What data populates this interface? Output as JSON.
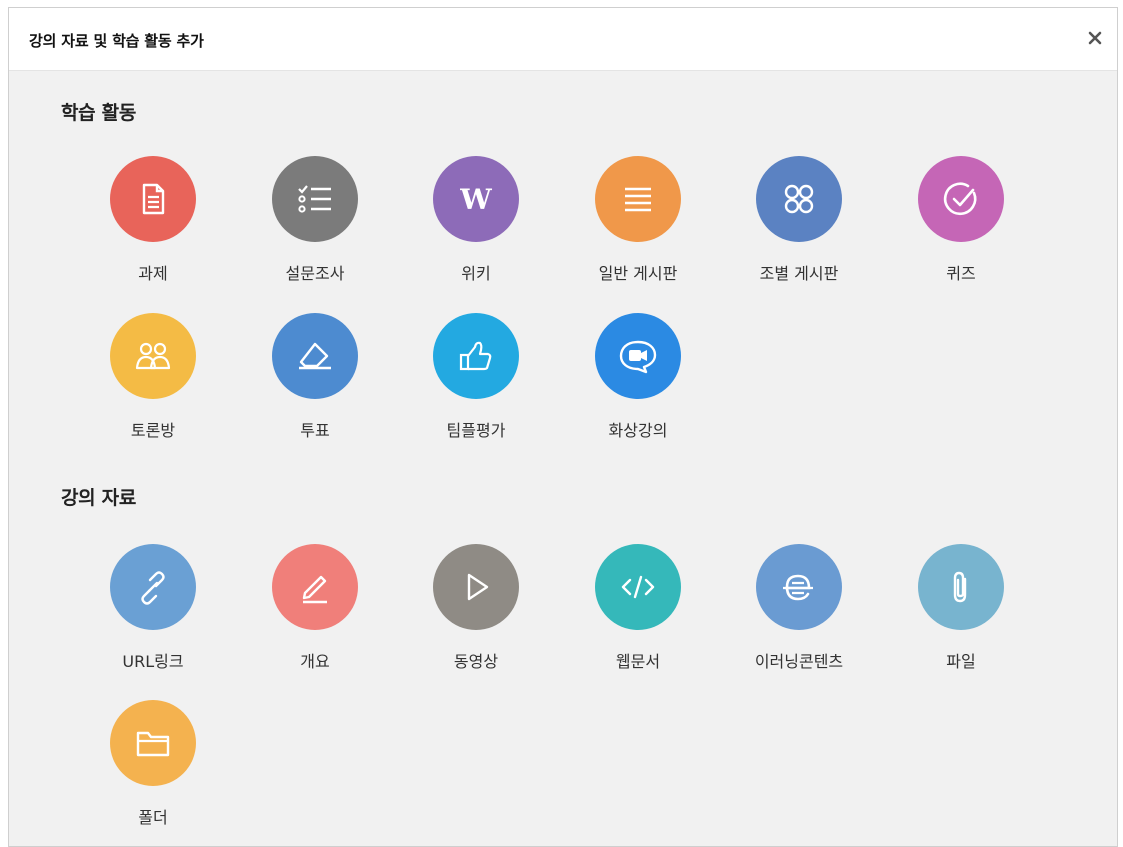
{
  "modal": {
    "title": "강의 자료 및 학습 활동 추가"
  },
  "sections": {
    "activities": {
      "title": "학습 활동",
      "items": [
        {
          "label": "과제",
          "icon": "document-icon",
          "color": "#e8645a"
        },
        {
          "label": "설문조사",
          "icon": "checklist-icon",
          "color": "#7b7b7b"
        },
        {
          "label": "위키",
          "icon": "wiki-icon",
          "color": "#8d6bb8"
        },
        {
          "label": "일반 게시판",
          "icon": "lines-icon",
          "color": "#f0984a"
        },
        {
          "label": "조별 게시판",
          "icon": "group-board-icon",
          "color": "#5b82c2"
        },
        {
          "label": "퀴즈",
          "icon": "check-circle-icon",
          "color": "#c566b6"
        },
        {
          "label": "토론방",
          "icon": "people-icon",
          "color": "#f4bb45"
        },
        {
          "label": "투표",
          "icon": "eraser-icon",
          "color": "#4d8bd0"
        },
        {
          "label": "팀플평가",
          "icon": "thumbs-up-icon",
          "color": "#23a9e1"
        },
        {
          "label": "화상강의",
          "icon": "video-chat-icon",
          "color": "#2b8ae3"
        }
      ]
    },
    "resources": {
      "title": "강의 자료",
      "items": [
        {
          "label": "URL링크",
          "icon": "link-icon",
          "color": "#6aa0d4"
        },
        {
          "label": "개요",
          "icon": "pencil-icon",
          "color": "#f07f7a"
        },
        {
          "label": "동영상",
          "icon": "play-icon",
          "color": "#8f8b85"
        },
        {
          "label": "웹문서",
          "icon": "code-icon",
          "color": "#35b8ba"
        },
        {
          "label": "이러닝콘텐츠",
          "icon": "elearning-icon",
          "color": "#6a9bd2"
        },
        {
          "label": "파일",
          "icon": "paperclip-icon",
          "color": "#78b4cf"
        },
        {
          "label": "폴더",
          "icon": "folder-icon",
          "color": "#f4b24f"
        }
      ]
    }
  }
}
